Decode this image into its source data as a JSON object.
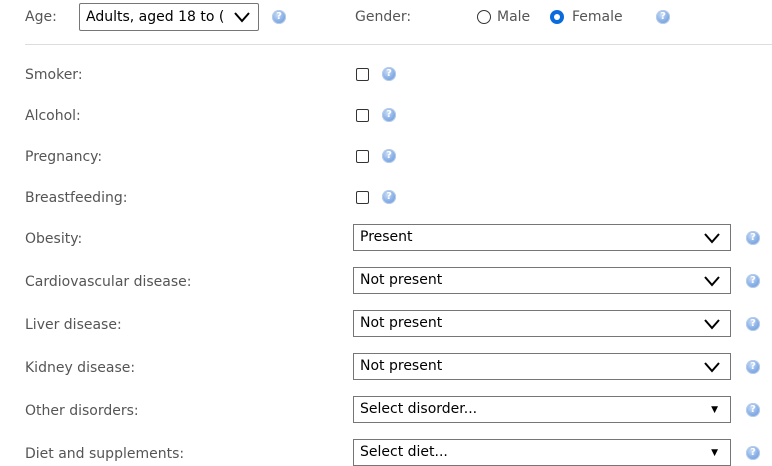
{
  "header": {
    "age_label": "Age:",
    "age_value": "Adults, aged 18 to (",
    "gender_label": "Gender:",
    "gender_options": [
      "Male",
      "Female"
    ],
    "gender_selected": "Female"
  },
  "checkbox_rows": [
    {
      "label": "Smoker:",
      "checked": false
    },
    {
      "label": "Alcohol:",
      "checked": false
    },
    {
      "label": "Pregnancy:",
      "checked": false
    },
    {
      "label": "Breastfeeding:",
      "checked": false
    }
  ],
  "select_rows": [
    {
      "label": "Obesity:",
      "value": "Present"
    },
    {
      "label": "Cardiovascular disease:",
      "value": "Not present"
    },
    {
      "label": "Liver disease:",
      "value": "Not present"
    },
    {
      "label": "Kidney disease:",
      "value": "Not present"
    },
    {
      "label": "Other disorders:",
      "value": "Select disorder..."
    },
    {
      "label": "Diet and supplements:",
      "value": "Select diet..."
    }
  ],
  "help_icon": "question-mark-help-icon",
  "colors": {
    "text": "#555555",
    "radio_selected": "#0a6cdc",
    "help": "#5b8fd6"
  }
}
